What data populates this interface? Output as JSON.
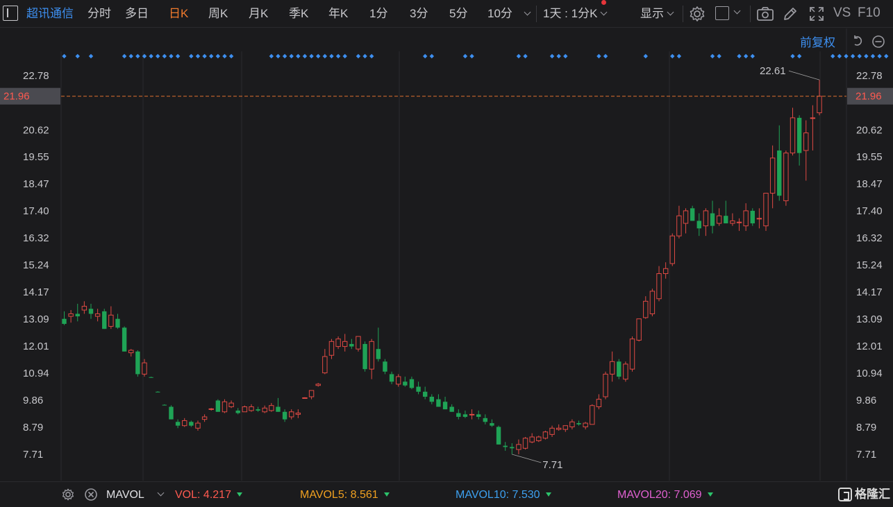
{
  "toolbar": {
    "stock_name": "超讯通信",
    "tabs": [
      {
        "label": "分时",
        "active": false
      },
      {
        "label": "多日",
        "active": false
      },
      {
        "label": "日K",
        "active": true
      },
      {
        "label": "周K",
        "active": false
      },
      {
        "label": "月K",
        "active": false
      },
      {
        "label": "季K",
        "active": false
      },
      {
        "label": "年K",
        "active": false
      },
      {
        "label": "1分",
        "active": false
      },
      {
        "label": "3分",
        "active": false
      },
      {
        "label": "5分",
        "active": false
      },
      {
        "label": "10分",
        "active": false
      }
    ],
    "period_select": "1天 : 1分K",
    "display_label": "显示",
    "vs_label": "VS",
    "f10_label": "F10",
    "icons": [
      "settings-gear-icon",
      "square-icon",
      "camera-icon",
      "pencil-icon",
      "fullscreen-icon"
    ]
  },
  "chart_header": {
    "adjust_label": "前复权"
  },
  "axis": {
    "y_ticks": [
      "22.78",
      "20.62",
      "19.55",
      "18.47",
      "17.40",
      "16.32",
      "15.24",
      "14.17",
      "13.09",
      "12.01",
      "10.94",
      "9.86",
      "8.79",
      "7.71"
    ],
    "current_price": "21.96"
  },
  "annotations": {
    "high_label": "22.61",
    "low_label": "7.71"
  },
  "indicators": {
    "name": "MAVOL",
    "vol_label": "VOL:",
    "vol_value": "4.217",
    "mavol5_label": "MAVOL5:",
    "mavol5_value": "8.561",
    "mavol10_label": "MAVOL10:",
    "mavol10_value": "7.530",
    "mavol20_label": "MAVOL20:",
    "mavol20_value": "7.069"
  },
  "logo": {
    "text": "格隆汇"
  },
  "colors": {
    "background": "#1b1b1d",
    "up": "#e04a44",
    "down": "#1fa356",
    "accent": "#f07a2d",
    "link": "#3d8ff0",
    "price_line": "#e07030",
    "mavol5": "#f0a020",
    "mavol10": "#3da0f0",
    "mavol20": "#e060d0"
  },
  "chart_data": {
    "type": "candlestick",
    "y_range": [
      7.71,
      22.78
    ],
    "marker_indices": [
      0,
      2,
      4,
      9,
      10,
      11,
      12,
      13,
      14,
      15,
      16,
      17,
      19,
      20,
      21,
      22,
      23,
      24,
      25,
      31,
      32,
      33,
      34,
      35,
      36,
      37,
      38,
      39,
      40,
      41,
      42,
      44,
      45,
      46,
      54,
      55,
      60,
      61,
      68,
      69,
      73,
      74,
      75,
      80,
      81,
      87,
      91,
      92,
      97,
      98,
      101,
      102,
      103,
      109,
      110,
      115,
      116,
      117,
      118,
      119,
      120,
      121,
      122,
      123
    ],
    "candles": [
      {
        "o": 13.1,
        "h": 13.4,
        "l": 12.85,
        "c": 12.9
      },
      {
        "o": 13.2,
        "h": 13.45,
        "l": 12.95,
        "c": 13.3
      },
      {
        "o": 13.3,
        "h": 13.7,
        "l": 13.0,
        "c": 13.2
      },
      {
        "o": 13.45,
        "h": 13.8,
        "l": 13.3,
        "c": 13.6
      },
      {
        "o": 13.5,
        "h": 13.7,
        "l": 13.1,
        "c": 13.3
      },
      {
        "o": 13.2,
        "h": 13.5,
        "l": 13.0,
        "c": 13.3
      },
      {
        "o": 13.4,
        "h": 13.5,
        "l": 12.7,
        "c": 12.7
      },
      {
        "o": 12.8,
        "h": 13.6,
        "l": 12.7,
        "c": 13.25
      },
      {
        "o": 13.1,
        "h": 13.3,
        "l": 12.7,
        "c": 12.75
      },
      {
        "o": 12.75,
        "h": 12.8,
        "l": 11.8,
        "c": 11.8
      },
      {
        "o": 11.75,
        "h": 11.9,
        "l": 11.6,
        "c": 11.85
      },
      {
        "o": 11.8,
        "h": 11.85,
        "l": 10.8,
        "c": 10.9
      },
      {
        "o": 10.9,
        "h": 11.5,
        "l": 10.8,
        "c": 11.35
      },
      {
        "o": 10.78,
        "h": 10.8,
        "l": 10.76,
        "c": 10.77
      },
      {
        "o": 10.2,
        "h": 10.22,
        "l": 10.18,
        "c": 10.19
      },
      {
        "o": 9.68,
        "h": 9.7,
        "l": 9.66,
        "c": 9.67
      },
      {
        "o": 9.6,
        "h": 9.66,
        "l": 9.1,
        "c": 9.1
      },
      {
        "o": 9.0,
        "h": 9.1,
        "l": 8.75,
        "c": 8.85
      },
      {
        "o": 8.85,
        "h": 9.15,
        "l": 8.8,
        "c": 9.05
      },
      {
        "o": 9.0,
        "h": 9.05,
        "l": 8.8,
        "c": 8.85
      },
      {
        "o": 8.75,
        "h": 9.05,
        "l": 8.65,
        "c": 8.95
      },
      {
        "o": 9.1,
        "h": 9.3,
        "l": 9.0,
        "c": 9.2
      },
      {
        "o": 9.5,
        "h": 9.55,
        "l": 9.45,
        "c": 9.52
      },
      {
        "o": 9.85,
        "h": 9.9,
        "l": 9.4,
        "c": 9.4
      },
      {
        "o": 9.4,
        "h": 9.9,
        "l": 9.35,
        "c": 9.8
      },
      {
        "o": 9.6,
        "h": 9.85,
        "l": 9.55,
        "c": 9.75
      },
      {
        "o": 9.45,
        "h": 9.55,
        "l": 9.3,
        "c": 9.35
      },
      {
        "o": 9.4,
        "h": 9.65,
        "l": 9.4,
        "c": 9.6
      },
      {
        "o": 9.45,
        "h": 9.7,
        "l": 9.4,
        "c": 9.6
      },
      {
        "o": 9.5,
        "h": 9.6,
        "l": 9.4,
        "c": 9.45
      },
      {
        "o": 9.4,
        "h": 9.65,
        "l": 9.35,
        "c": 9.55
      },
      {
        "o": 9.45,
        "h": 9.75,
        "l": 9.4,
        "c": 9.65
      },
      {
        "o": 9.6,
        "h": 9.95,
        "l": 9.4,
        "c": 9.4
      },
      {
        "o": 9.4,
        "h": 9.5,
        "l": 9.0,
        "c": 9.1
      },
      {
        "o": 9.2,
        "h": 9.5,
        "l": 9.1,
        "c": 9.4
      },
      {
        "o": 9.3,
        "h": 9.5,
        "l": 9.15,
        "c": 9.35
      },
      {
        "o": 9.95,
        "h": 9.98,
        "l": 9.93,
        "c": 9.96
      },
      {
        "o": 10.0,
        "h": 10.2,
        "l": 9.9,
        "c": 10.25
      },
      {
        "o": 10.45,
        "h": 10.55,
        "l": 10.4,
        "c": 10.5
      },
      {
        "o": 10.95,
        "h": 11.9,
        "l": 10.9,
        "c": 11.6
      },
      {
        "o": 11.65,
        "h": 12.3,
        "l": 11.5,
        "c": 12.2
      },
      {
        "o": 12.0,
        "h": 12.4,
        "l": 11.9,
        "c": 12.3
      },
      {
        "o": 12.0,
        "h": 12.5,
        "l": 11.8,
        "c": 12.2
      },
      {
        "o": 12.1,
        "h": 12.3,
        "l": 11.9,
        "c": 12.0
      },
      {
        "o": 11.9,
        "h": 12.4,
        "l": 11.8,
        "c": 12.4
      },
      {
        "o": 12.1,
        "h": 12.2,
        "l": 11.0,
        "c": 11.1
      },
      {
        "o": 11.1,
        "h": 12.3,
        "l": 10.7,
        "c": 12.2
      },
      {
        "o": 11.9,
        "h": 12.75,
        "l": 11.4,
        "c": 11.5
      },
      {
        "o": 11.4,
        "h": 11.5,
        "l": 10.9,
        "c": 11.0
      },
      {
        "o": 10.9,
        "h": 11.0,
        "l": 10.5,
        "c": 10.6
      },
      {
        "o": 10.5,
        "h": 10.9,
        "l": 10.4,
        "c": 10.8
      },
      {
        "o": 10.6,
        "h": 10.8,
        "l": 10.4,
        "c": 10.45
      },
      {
        "o": 10.7,
        "h": 10.8,
        "l": 10.3,
        "c": 10.35
      },
      {
        "o": 10.4,
        "h": 10.6,
        "l": 10.1,
        "c": 10.2
      },
      {
        "o": 10.2,
        "h": 10.4,
        "l": 9.9,
        "c": 10.0
      },
      {
        "o": 10.0,
        "h": 10.1,
        "l": 9.7,
        "c": 9.8
      },
      {
        "o": 9.9,
        "h": 10.1,
        "l": 9.6,
        "c": 9.6
      },
      {
        "o": 9.8,
        "h": 10.0,
        "l": 9.5,
        "c": 9.5
      },
      {
        "o": 9.6,
        "h": 9.7,
        "l": 9.4,
        "c": 9.4
      },
      {
        "o": 9.35,
        "h": 9.5,
        "l": 9.1,
        "c": 9.2
      },
      {
        "o": 9.3,
        "h": 9.45,
        "l": 9.15,
        "c": 9.2
      },
      {
        "o": 9.3,
        "h": 9.5,
        "l": 9.1,
        "c": 9.3
      },
      {
        "o": 9.3,
        "h": 9.45,
        "l": 9.1,
        "c": 9.2
      },
      {
        "o": 9.15,
        "h": 9.3,
        "l": 8.9,
        "c": 9.0
      },
      {
        "o": 8.95,
        "h": 9.1,
        "l": 8.8,
        "c": 8.85
      },
      {
        "o": 8.8,
        "h": 8.85,
        "l": 8.1,
        "c": 8.1
      },
      {
        "o": 8.05,
        "h": 8.2,
        "l": 7.85,
        "c": 8.0
      },
      {
        "o": 8.0,
        "h": 8.15,
        "l": 7.71,
        "c": 7.95
      },
      {
        "o": 7.9,
        "h": 8.3,
        "l": 7.71,
        "c": 8.1
      },
      {
        "o": 7.95,
        "h": 8.4,
        "l": 7.9,
        "c": 8.35
      },
      {
        "o": 8.2,
        "h": 8.55,
        "l": 8.15,
        "c": 8.4
      },
      {
        "o": 8.25,
        "h": 8.45,
        "l": 8.2,
        "c": 8.4
      },
      {
        "o": 8.35,
        "h": 8.65,
        "l": 8.3,
        "c": 8.6
      },
      {
        "o": 8.5,
        "h": 8.85,
        "l": 8.4,
        "c": 8.75
      },
      {
        "o": 8.7,
        "h": 8.9,
        "l": 8.65,
        "c": 8.75
      },
      {
        "o": 8.7,
        "h": 8.85,
        "l": 8.6,
        "c": 8.85
      },
      {
        "o": 8.8,
        "h": 9.1,
        "l": 8.7,
        "c": 9.0
      },
      {
        "o": 8.95,
        "h": 9.05,
        "l": 8.85,
        "c": 8.9
      },
      {
        "o": 8.8,
        "h": 9.0,
        "l": 8.7,
        "c": 8.95
      },
      {
        "o": 8.9,
        "h": 9.7,
        "l": 8.9,
        "c": 9.65
      },
      {
        "o": 9.6,
        "h": 10.1,
        "l": 9.5,
        "c": 9.9
      },
      {
        "o": 10.0,
        "h": 11.0,
        "l": 9.9,
        "c": 10.9
      },
      {
        "o": 10.9,
        "h": 11.8,
        "l": 10.6,
        "c": 11.4
      },
      {
        "o": 11.4,
        "h": 11.5,
        "l": 10.7,
        "c": 10.8
      },
      {
        "o": 10.7,
        "h": 11.4,
        "l": 10.6,
        "c": 11.3
      },
      {
        "o": 11.1,
        "h": 12.4,
        "l": 11.0,
        "c": 12.3
      },
      {
        "o": 12.25,
        "h": 13.1,
        "l": 12.2,
        "c": 13.1
      },
      {
        "o": 13.15,
        "h": 14.0,
        "l": 13.1,
        "c": 13.8
      },
      {
        "o": 13.3,
        "h": 14.3,
        "l": 13.2,
        "c": 14.2
      },
      {
        "o": 13.9,
        "h": 15.2,
        "l": 13.8,
        "c": 14.9
      },
      {
        "o": 14.9,
        "h": 15.35,
        "l": 14.7,
        "c": 15.1
      },
      {
        "o": 15.3,
        "h": 16.5,
        "l": 15.2,
        "c": 16.4
      },
      {
        "o": 16.4,
        "h": 17.6,
        "l": 16.3,
        "c": 17.2
      },
      {
        "o": 16.9,
        "h": 17.5,
        "l": 16.5,
        "c": 17.4
      },
      {
        "o": 17.5,
        "h": 17.6,
        "l": 17.0,
        "c": 17.0
      },
      {
        "o": 17.0,
        "h": 17.3,
        "l": 16.4,
        "c": 16.7
      },
      {
        "o": 16.8,
        "h": 17.5,
        "l": 16.4,
        "c": 17.4
      },
      {
        "o": 17.3,
        "h": 17.8,
        "l": 16.5,
        "c": 16.8
      },
      {
        "o": 16.9,
        "h": 17.5,
        "l": 16.8,
        "c": 17.2
      },
      {
        "o": 17.2,
        "h": 17.8,
        "l": 16.9,
        "c": 16.9
      },
      {
        "o": 16.9,
        "h": 17.3,
        "l": 16.8,
        "c": 17.0
      },
      {
        "o": 16.95,
        "h": 17.1,
        "l": 16.6,
        "c": 16.95
      },
      {
        "o": 16.8,
        "h": 17.7,
        "l": 16.6,
        "c": 17.4
      },
      {
        "o": 17.4,
        "h": 17.5,
        "l": 16.8,
        "c": 16.9
      },
      {
        "o": 17.1,
        "h": 17.5,
        "l": 16.7,
        "c": 17.1
      },
      {
        "o": 16.8,
        "h": 17.9,
        "l": 16.6,
        "c": 18.1
      },
      {
        "o": 18.1,
        "h": 20.0,
        "l": 17.5,
        "c": 19.5
      },
      {
        "o": 19.8,
        "h": 20.8,
        "l": 17.8,
        "c": 18.0
      },
      {
        "o": 17.8,
        "h": 19.8,
        "l": 17.6,
        "c": 19.7
      },
      {
        "o": 19.7,
        "h": 21.5,
        "l": 19.6,
        "c": 21.1
      },
      {
        "o": 21.1,
        "h": 21.2,
        "l": 19.2,
        "c": 19.7
      },
      {
        "o": 19.8,
        "h": 21.0,
        "l": 18.6,
        "c": 20.5
      },
      {
        "o": 21.1,
        "h": 21.6,
        "l": 19.8,
        "c": 21.1
      },
      {
        "o": 21.3,
        "h": 22.61,
        "l": 21.2,
        "c": 21.96
      }
    ]
  }
}
